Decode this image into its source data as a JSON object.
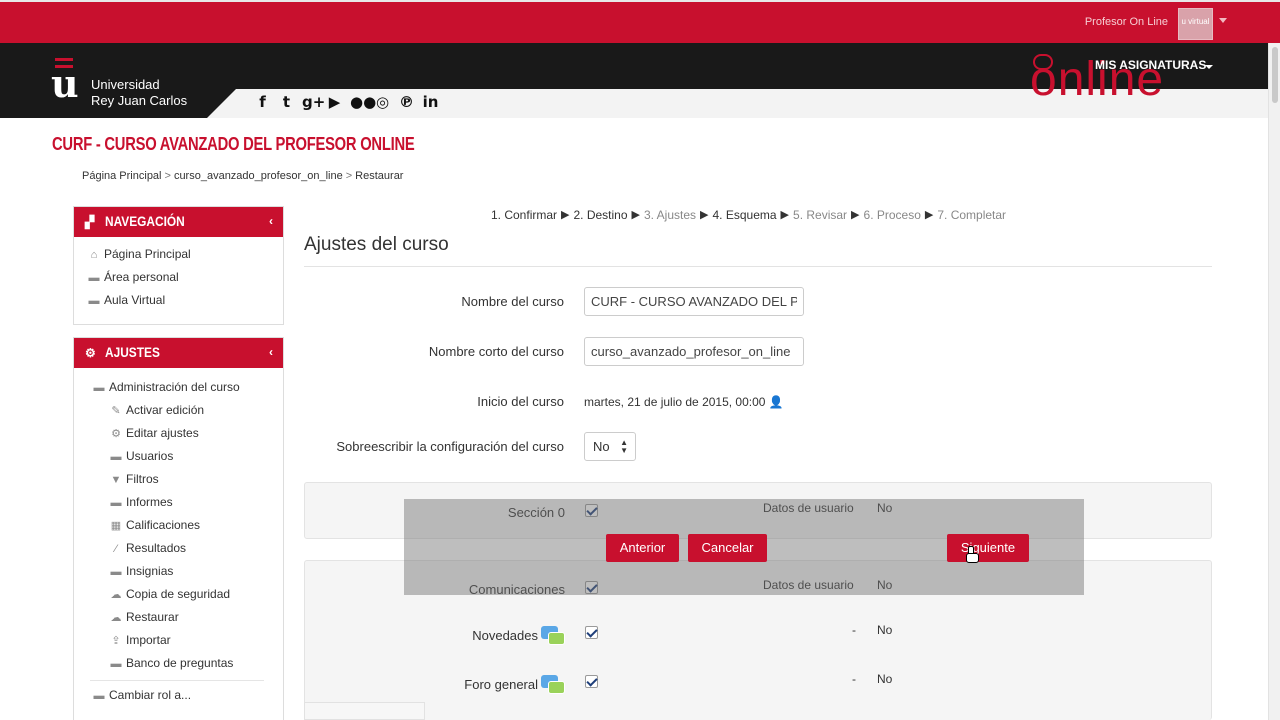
{
  "topbar": {
    "user_name": "Profesor On Line",
    "avatar_text": "u virtual"
  },
  "header": {
    "logo_line1": "Universidad",
    "logo_line2": "Rey Juan Carlos",
    "social_icons": [
      "facebook-icon",
      "twitter-icon",
      "google-plus-icon",
      "youtube-icon",
      "flickr-icon",
      "instagram-icon",
      "pinterest-icon",
      "linkedin-icon"
    ],
    "social_glyphs": [
      "f",
      "t",
      "g+",
      "▶",
      "●●",
      "◎",
      "℗",
      "in"
    ],
    "online_logo": "online",
    "my_subjects": "MIS ASIGNATURAS"
  },
  "page": {
    "course_title": "CURF - CURSO AVANZADO DEL PROFESOR ONLINE",
    "breadcrumb": [
      "Página Principal",
      "curso_avanzado_profesor_on_line",
      "Restaurar"
    ],
    "breadcrumb_sep": ">"
  },
  "navigation": {
    "title": "NAVEGACIÓN",
    "collapse": "‹",
    "items": [
      {
        "label": "Página Principal",
        "icon": "home-icon"
      },
      {
        "label": "Área personal",
        "icon": "folder-icon"
      },
      {
        "label": "Aula Virtual",
        "icon": "folder-icon"
      }
    ]
  },
  "settings": {
    "title": "AJUSTES",
    "collapse": "‹",
    "root": "Administración del curso",
    "items": [
      {
        "label": "Activar edición",
        "icon": "pencil-icon"
      },
      {
        "label": "Editar ajustes",
        "icon": "gears-icon"
      },
      {
        "label": "Usuarios",
        "icon": "folder-icon"
      },
      {
        "label": "Filtros",
        "icon": "filter-icon"
      },
      {
        "label": "Informes",
        "icon": "folder-icon"
      },
      {
        "label": "Calificaciones",
        "icon": "table-icon"
      },
      {
        "label": "Resultados",
        "icon": "wand-icon"
      },
      {
        "label": "Insignias",
        "icon": "folder-icon"
      },
      {
        "label": "Copia de seguridad",
        "icon": "cloud-upload-icon"
      },
      {
        "label": "Restaurar",
        "icon": "cloud-upload-icon"
      },
      {
        "label": "Importar",
        "icon": "upload-icon"
      },
      {
        "label": "Banco de preguntas",
        "icon": "folder-icon"
      }
    ],
    "switch_role": "Cambiar rol a..."
  },
  "steps": [
    {
      "label": "1. Confirmar",
      "state": "done"
    },
    {
      "label": "2. Destino",
      "state": "done"
    },
    {
      "label": "3. Ajustes",
      "state": "muted"
    },
    {
      "label": "4. Esquema",
      "state": "current"
    },
    {
      "label": "5. Revisar",
      "state": "muted"
    },
    {
      "label": "6. Proceso",
      "state": "muted"
    },
    {
      "label": "7. Completar",
      "state": "muted"
    }
  ],
  "form": {
    "title": "Ajustes del curso",
    "course_name_label": "Nombre del curso",
    "course_name_value": "CURF - CURSO AVANZADO DEL PROFESOR ONLINE",
    "short_name_label": "Nombre corto del curso",
    "short_name_value": "curso_avanzado_profesor_on_line",
    "start_label": "Inicio del curso",
    "start_value": "martes, 21 de julio de 2015, 00:00",
    "overwrite_label": "Sobreescribir la configuración del curso",
    "overwrite_value": "No"
  },
  "sections": {
    "section0_label": "Sección 0",
    "user_data_label": "Datos de usuario",
    "user_data_value": "No",
    "comms_label": "Comunicaciones",
    "comms_user_data_label": "Datos de usuario",
    "comms_user_data_value": "No",
    "news_label": "Novedades",
    "news_dash": "-",
    "news_value": "No",
    "forum_label": "Foro general",
    "forum_dash": "-",
    "forum_value": "No"
  },
  "buttons": {
    "previous": "Anterior",
    "cancel": "Cancelar",
    "next": "Siguiente"
  },
  "colors": {
    "brand_red": "#c8102e",
    "header_dark": "#191919"
  }
}
